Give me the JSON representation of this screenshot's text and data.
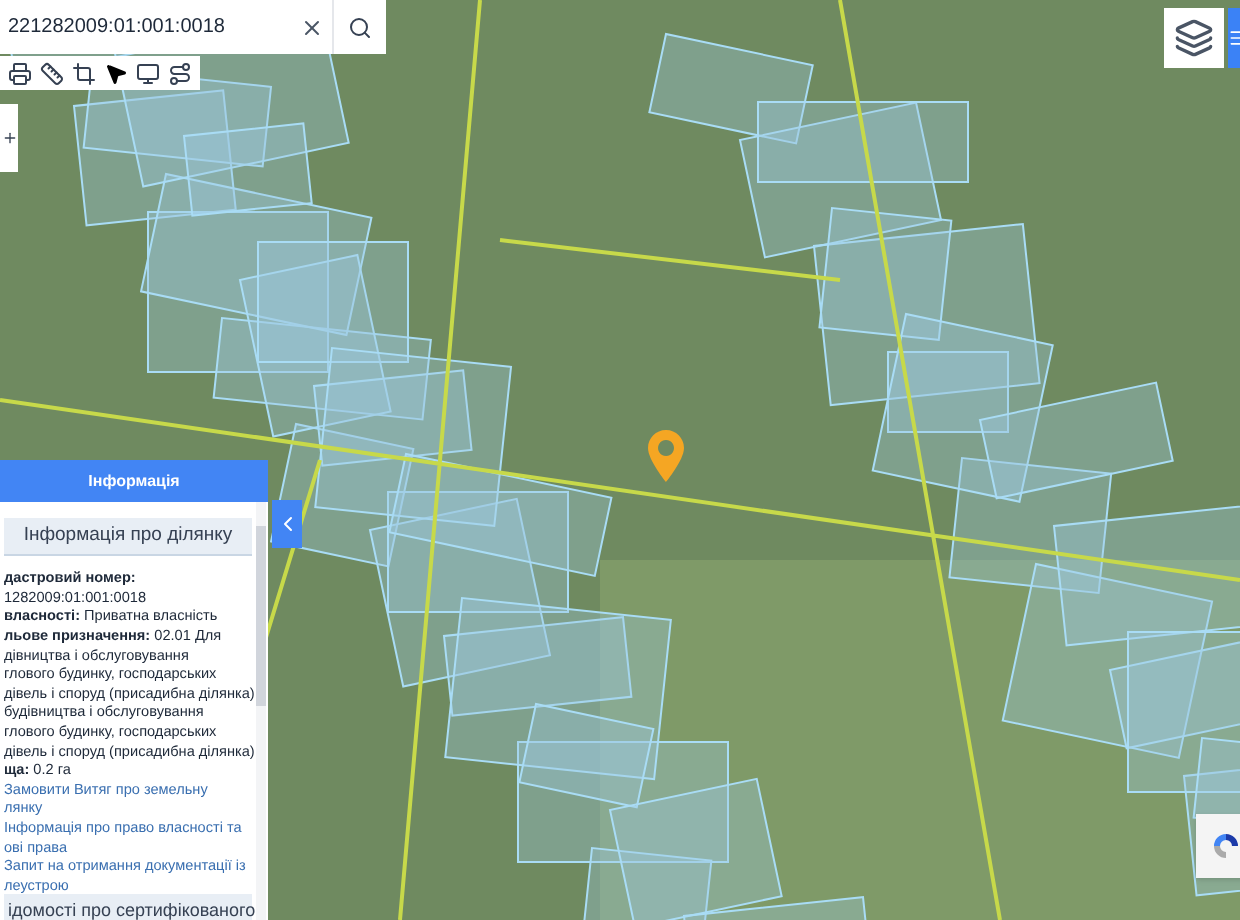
{
  "search": {
    "value": "221282009:01:001:0018"
  },
  "info_panel": {
    "title": "Інформація",
    "section": "Інформація про ділянку",
    "lines": [
      {
        "kind": "label",
        "text": "дастровий номер:"
      },
      {
        "kind": "plain",
        "text": "1282009:01:001:0018"
      },
      {
        "kind": "plain",
        "text": "**власності:** Приватна власність"
      },
      {
        "kind": "plain",
        "text": "**льове призначення:** 02.01 Для"
      },
      {
        "kind": "plain",
        "text": "дівництва і обслуговування"
      },
      {
        "kind": "plain",
        "text": "глового будинку, господарських"
      },
      {
        "kind": "plain",
        "text": "дівель і споруд (присадибна ділянка)"
      },
      {
        "kind": "plain",
        "text": "будівництва і обслуговування"
      },
      {
        "kind": "plain",
        "text": "глового будинку, господарських"
      },
      {
        "kind": "plain",
        "text": "дівель і споруд (присадибна ділянка)"
      },
      {
        "kind": "plain",
        "text": "**щa:** 0.2 га"
      },
      {
        "kind": "link",
        "text": "Замовити Витяг про земельну"
      },
      {
        "kind": "link",
        "text": "лянку"
      },
      {
        "kind": "link",
        "text": "Інформація про право власності та"
      },
      {
        "kind": "link",
        "text": "ові права"
      },
      {
        "kind": "link",
        "text": "Запит на отримання документації із"
      },
      {
        "kind": "link",
        "text": "леустрою"
      }
    ],
    "next_section": "ідомості про сертифікованого"
  }
}
